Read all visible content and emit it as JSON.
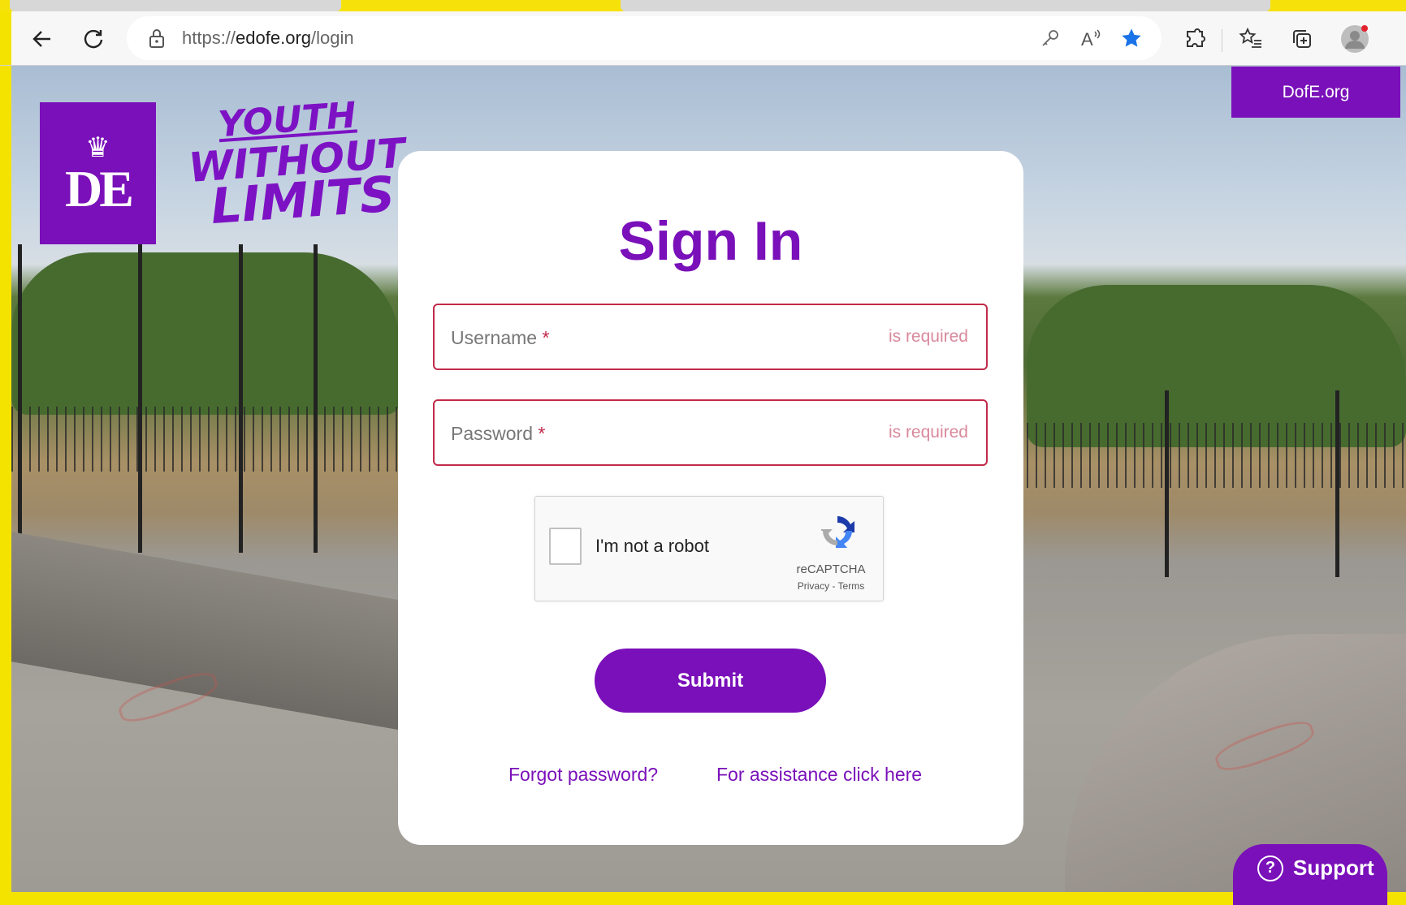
{
  "browser": {
    "url_prefix": "https://",
    "url_domain": "edofe.org",
    "url_path": "/login",
    "icons": [
      "back-icon",
      "refresh-icon",
      "lock-icon",
      "key-icon",
      "read-aloud-icon",
      "star-icon",
      "extensions-icon",
      "favorites-icon",
      "collections-icon",
      "profile-icon"
    ]
  },
  "header": {
    "tagline_line1": "YOUTH",
    "tagline_line2": "WITHOUT",
    "tagline_line3": "LIMITS",
    "dofe_link": "DofE.org"
  },
  "login": {
    "title": "Sign In",
    "username_label": "Username",
    "password_label": "Password",
    "required_marker": "*",
    "username_error": "is required",
    "password_error": "is required",
    "captcha_label": "I'm not a robot",
    "captcha_brand": "reCAPTCHA",
    "captcha_links": "Privacy - Terms",
    "submit_label": "Submit",
    "forgot_password": "Forgot password?",
    "assistance": "For assistance click here"
  },
  "support": {
    "label": "Support"
  },
  "colors": {
    "brand_purple": "#7a10b9",
    "error_red": "#c22a4a"
  }
}
